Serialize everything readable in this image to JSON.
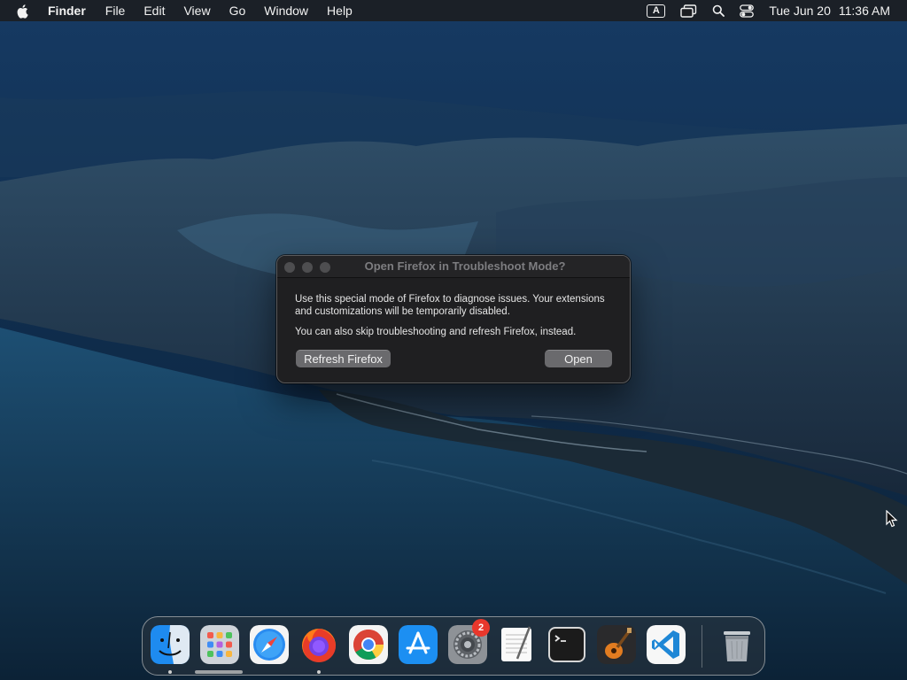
{
  "menubar": {
    "app_name": "Finder",
    "menus": [
      "File",
      "Edit",
      "View",
      "Go",
      "Window",
      "Help"
    ],
    "input_source": "A",
    "date": "Tue Jun 20",
    "time": "11:36 AM"
  },
  "dialog": {
    "title": "Open Firefox in Troubleshoot Mode?",
    "message": "Use this special mode of Firefox to diagnose issues. Your extensions and customizations will be temporarily disabled.",
    "secondary_message": "You can also skip troubleshooting and refresh Firefox, instead.",
    "refresh_button": "Refresh Firefox",
    "open_button": "Open"
  },
  "dock": {
    "apps": [
      {
        "icon": "finder-icon",
        "running": true
      },
      {
        "icon": "launchpad-icon",
        "running": false
      },
      {
        "icon": "safari-icon",
        "running": false
      },
      {
        "icon": "firefox-icon",
        "running": true
      },
      {
        "icon": "chrome-icon",
        "running": false
      },
      {
        "icon": "app-store-icon",
        "running": false
      },
      {
        "icon": "system-preferences-icon",
        "running": false,
        "badge": "2"
      },
      {
        "icon": "textedit-icon",
        "running": false
      },
      {
        "icon": "terminal-icon",
        "running": false
      },
      {
        "icon": "garageband-icon",
        "running": false
      },
      {
        "icon": "vscode-icon",
        "running": false
      },
      {
        "icon": "trash-icon",
        "running": false
      }
    ],
    "system_preferences_badge": "2"
  },
  "colors": {
    "menubar_bg": "#1c1e22",
    "dialog_bg": "#1f1f21",
    "button_bg": "#6a6a6d",
    "badge_red": "#e8372c"
  }
}
